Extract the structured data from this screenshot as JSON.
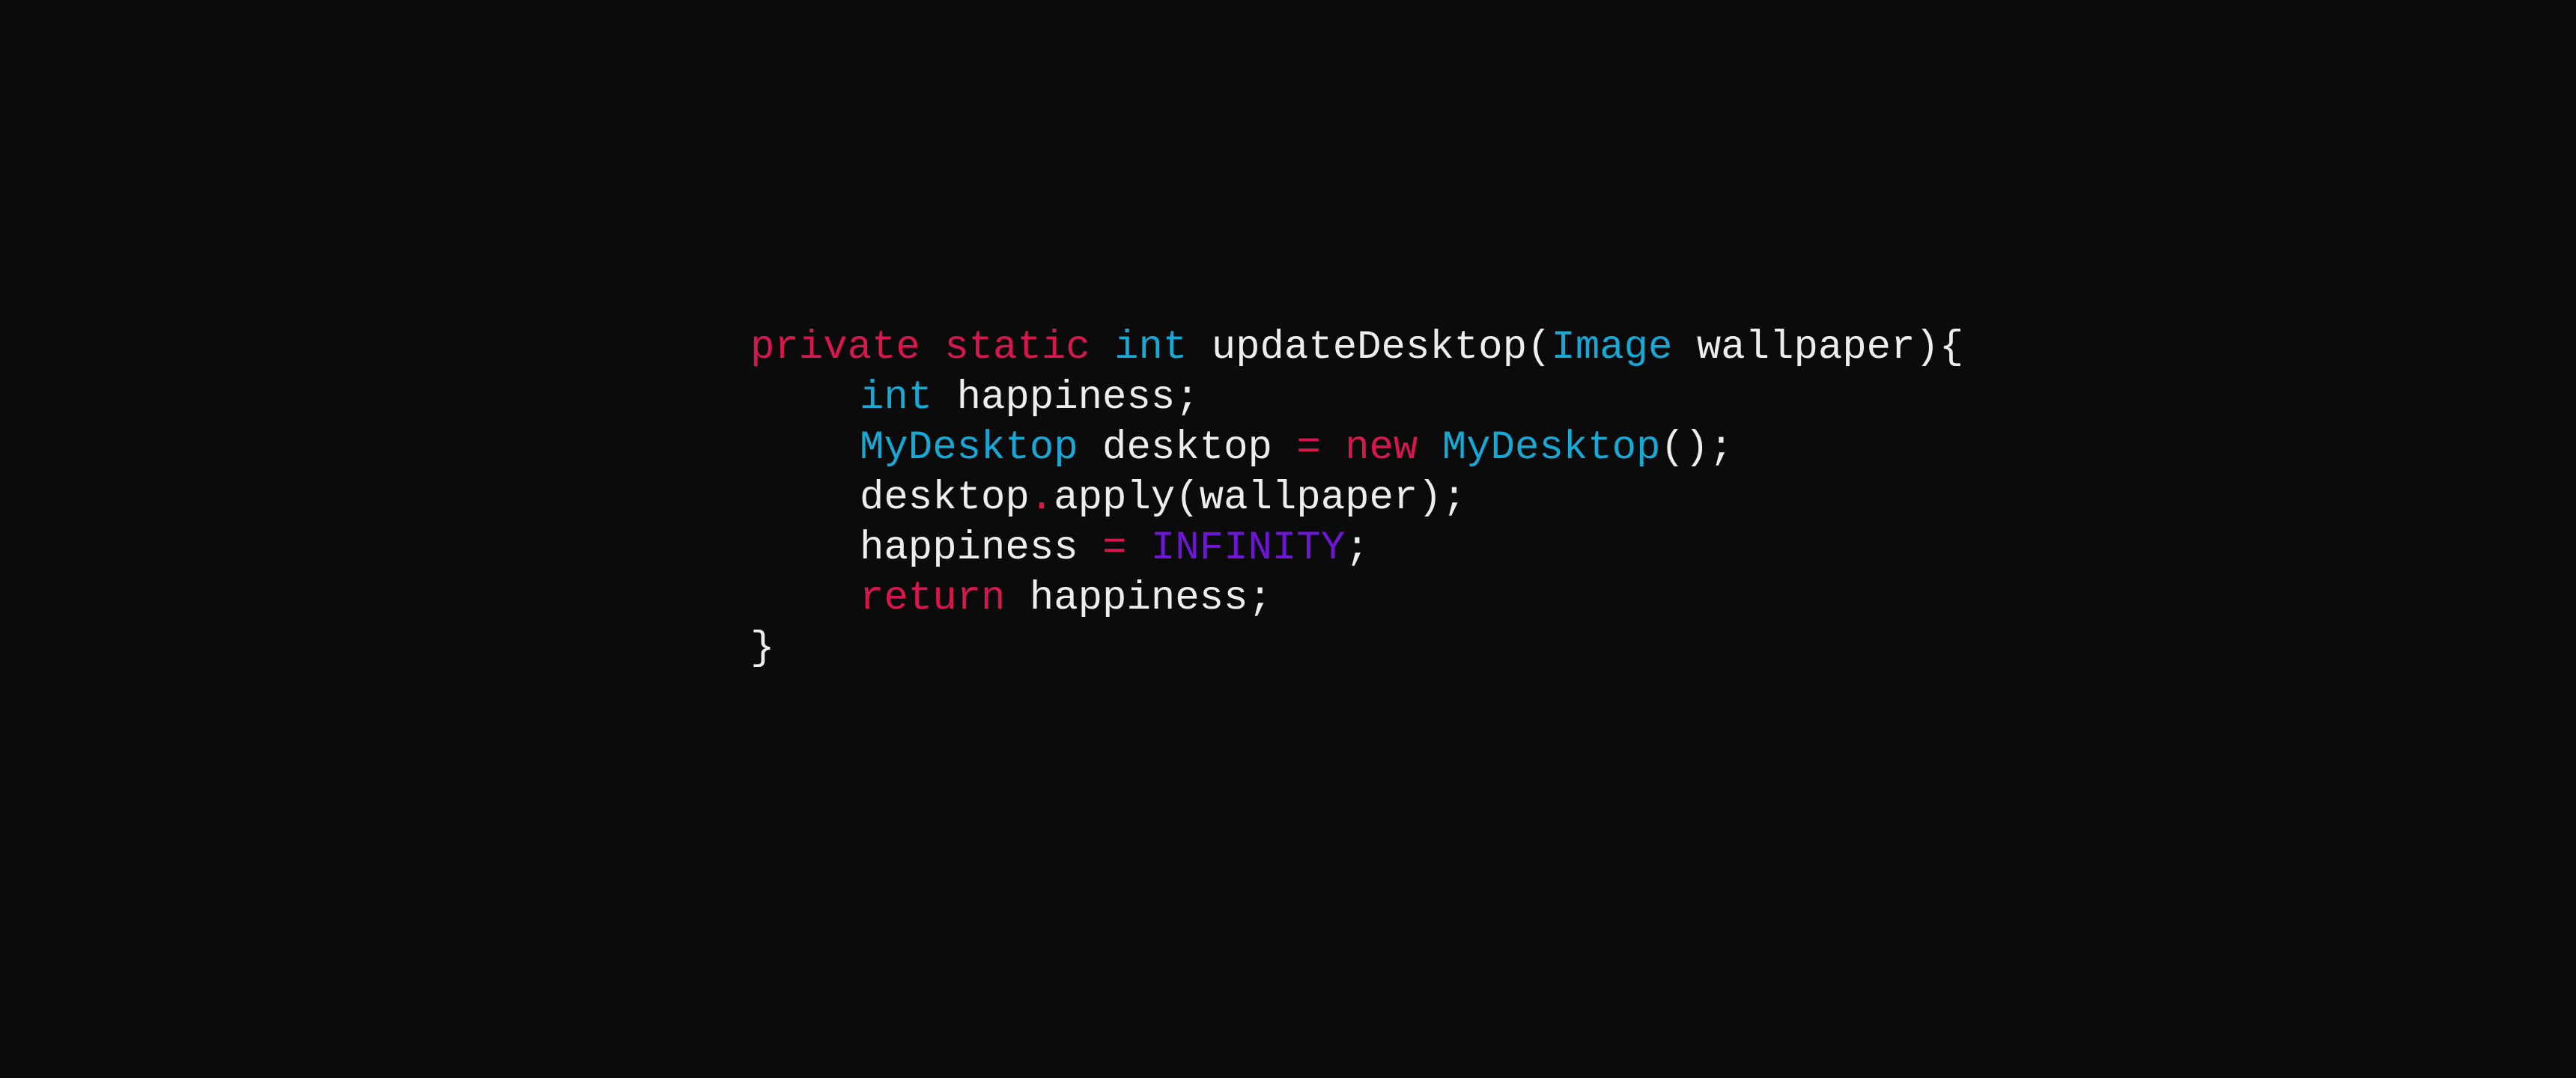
{
  "colors": {
    "background": "#0b0b0b",
    "default": "#ededed",
    "keyword": "#d8174f",
    "type": "#16a9d6",
    "constant": "#6d16d6",
    "operator": "#d8174f"
  },
  "code_lines": [
    {
      "indent": 0,
      "tokens": [
        {
          "text": "private",
          "kind": "keyword"
        },
        {
          "text": " ",
          "kind": "default"
        },
        {
          "text": "static",
          "kind": "keyword"
        },
        {
          "text": " ",
          "kind": "default"
        },
        {
          "text": "int",
          "kind": "type"
        },
        {
          "text": " updateDesktop(",
          "kind": "default"
        },
        {
          "text": "Image",
          "kind": "type"
        },
        {
          "text": " wallpaper){",
          "kind": "default"
        }
      ]
    },
    {
      "indent": 1,
      "tokens": [
        {
          "text": "int",
          "kind": "type"
        },
        {
          "text": " happiness;",
          "kind": "default"
        }
      ]
    },
    {
      "indent": 1,
      "tokens": [
        {
          "text": "MyDesktop",
          "kind": "type"
        },
        {
          "text": " desktop ",
          "kind": "default"
        },
        {
          "text": "=",
          "kind": "operator"
        },
        {
          "text": " ",
          "kind": "default"
        },
        {
          "text": "new",
          "kind": "keyword"
        },
        {
          "text": " ",
          "kind": "default"
        },
        {
          "text": "MyDesktop",
          "kind": "type"
        },
        {
          "text": "();",
          "kind": "default"
        }
      ]
    },
    {
      "indent": 1,
      "tokens": [
        {
          "text": "desktop",
          "kind": "default"
        },
        {
          "text": ".",
          "kind": "operator"
        },
        {
          "text": "apply(wallpaper);",
          "kind": "default"
        }
      ]
    },
    {
      "indent": 1,
      "tokens": [
        {
          "text": "happiness ",
          "kind": "default"
        },
        {
          "text": "=",
          "kind": "operator"
        },
        {
          "text": " ",
          "kind": "default"
        },
        {
          "text": "INFINITY",
          "kind": "constant"
        },
        {
          "text": ";",
          "kind": "default"
        }
      ]
    },
    {
      "indent": 1,
      "tokens": [
        {
          "text": "return",
          "kind": "keyword"
        },
        {
          "text": " happiness;",
          "kind": "default"
        }
      ]
    },
    {
      "indent": 0,
      "tokens": [
        {
          "text": "}",
          "kind": "default"
        }
      ]
    }
  ]
}
